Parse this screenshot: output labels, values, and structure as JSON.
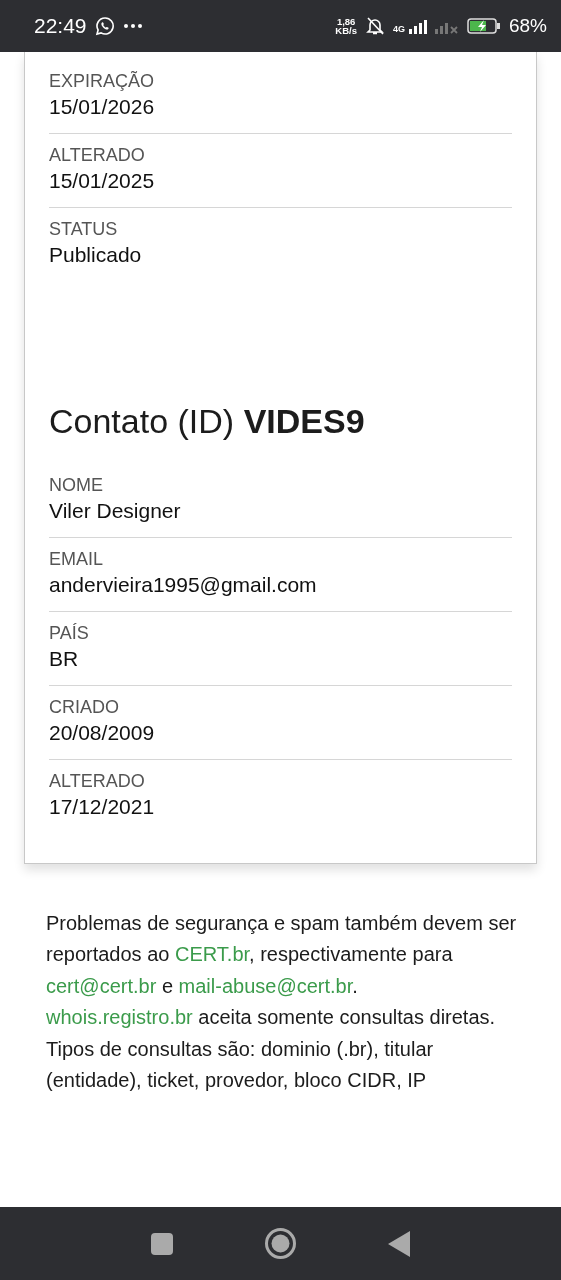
{
  "status_bar": {
    "time": "22:49",
    "net_speed": "1,86",
    "net_speed_unit": "KB/s",
    "network_type": "4G",
    "battery": "68%",
    "battery_charging": true
  },
  "domain_fields": [
    {
      "label": "EXPIRAÇÃO",
      "value": "15/01/2026"
    },
    {
      "label": "ALTERADO",
      "value": "15/01/2025"
    },
    {
      "label": "STATUS",
      "value": "Publicado"
    }
  ],
  "contact": {
    "title": "Contato (ID) **VIDES9**",
    "fields": [
      {
        "label": "NOME",
        "value": "Viler Designer"
      },
      {
        "label": "EMAIL",
        "value": "andervieira1995@gmail.com"
      },
      {
        "label": "PAÍS",
        "value": "BR"
      },
      {
        "label": "CRIADO",
        "value": "20/08/2009"
      },
      {
        "label": "ALTERADO",
        "value": "17/12/2021"
      }
    ]
  },
  "notice": [
    {
      "text": "Problemas de segurança e spam também devem ser reportados ao ",
      "link": false
    },
    {
      "text": "CERT.br",
      "link": true
    },
    {
      "text": ", respectivamente para ",
      "link": false
    },
    {
      "text": "cert@cert.br",
      "link": true
    },
    {
      "text": " e ",
      "link": false
    },
    {
      "text": "mail-abuse@cert.br",
      "link": true
    },
    {
      "text": ".",
      "link": false
    },
    {
      "text": "whois.registro.br",
      "link": true,
      "break_before": true
    },
    {
      "text": " aceita somente consultas diretas. Tipos de consultas são: dominio (.br), titular (entidade), ticket, provedor, bloco CIDR, IP",
      "link": false
    }
  ]
}
